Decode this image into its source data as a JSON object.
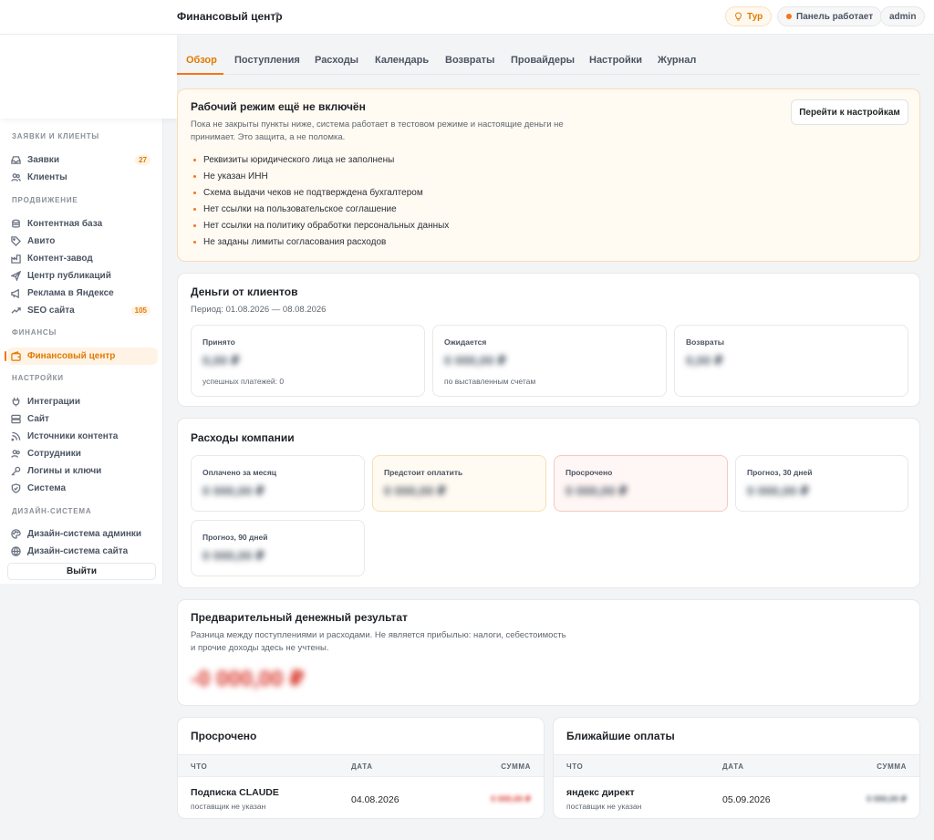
{
  "header": {
    "title": "Финансовый центр",
    "help": "?",
    "tour_label": "Тур",
    "status_label": "Панель работает",
    "user_label": "admin"
  },
  "sidebar": {
    "sections": [
      {
        "label": "ЗАЯВКИ И КЛИЕНТЫ"
      },
      {
        "label": "ПРОДВИЖЕНИЕ"
      },
      {
        "label": "ФИНАНСЫ"
      },
      {
        "label": "НАСТРОЙКИ"
      },
      {
        "label": "ДИЗАЙН-СИСТЕМА"
      }
    ],
    "items": [
      {
        "label": "Заявки",
        "icon": "inbox-icon",
        "badge": "27"
      },
      {
        "label": "Клиенты",
        "icon": "users-icon"
      },
      {
        "label": "Контентная база",
        "icon": "database-icon"
      },
      {
        "label": "Авито",
        "icon": "tag-icon"
      },
      {
        "label": "Контент-завод",
        "icon": "factory-icon"
      },
      {
        "label": "Центр публикаций",
        "icon": "send-icon"
      },
      {
        "label": "Реклама в Яндексе",
        "icon": "megaphone-icon"
      },
      {
        "label": "SEO сайта",
        "icon": "trending-icon",
        "badge": "105"
      },
      {
        "label": "Финансовый центр",
        "icon": "wallet-icon",
        "active": true
      },
      {
        "label": "Интеграции",
        "icon": "plug-icon"
      },
      {
        "label": "Сайт",
        "icon": "server-icon"
      },
      {
        "label": "Источники контента",
        "icon": "rss-icon"
      },
      {
        "label": "Сотрудники",
        "icon": "team-icon"
      },
      {
        "label": "Логины и ключи",
        "icon": "key-icon"
      },
      {
        "label": "Система",
        "icon": "shield-icon"
      },
      {
        "label": "Дизайн-система админки",
        "icon": "palette-icon"
      },
      {
        "label": "Дизайн-система сайта",
        "icon": "globe-icon"
      }
    ],
    "logout_label": "Выйти"
  },
  "tabs": [
    {
      "label": "Обзор",
      "active": true
    },
    {
      "label": "Поступления"
    },
    {
      "label": "Расходы"
    },
    {
      "label": "Календарь"
    },
    {
      "label": "Возвраты"
    },
    {
      "label": "Провайдеры"
    },
    {
      "label": "Настройки"
    },
    {
      "label": "Журнал"
    }
  ],
  "warning": {
    "title": "Рабочий режим ещё не включён",
    "text_line1": "Пока не закрыты пункты ниже, система работает в тестовом режиме и настоящие деньги не",
    "text_line2": "принимает. Это защита, а не поломка.",
    "button_label": "Перейти к настройкам",
    "items": [
      "Реквизиты юридического лица не заполнены",
      "Не указан ИНН",
      "Схема выдачи чеков не подтверждена бухгалтером",
      "Нет ссылки на пользовательское соглашение",
      "Нет ссылки на политику обработки персональных данных",
      "Не заданы лимиты согласования расходов"
    ]
  },
  "client_money": {
    "title": "Деньги от клиентов",
    "period": "Период: 01.08.2026 — 08.08.2026",
    "stats": [
      {
        "label": "Принято",
        "value": "0,00 ₽",
        "sub": "успешных платежей: 0"
      },
      {
        "label": "Ожидается",
        "value": "0 000,00 ₽",
        "sub": "по выставленным счетам"
      },
      {
        "label": "Возвраты",
        "value": "0,00 ₽",
        "sub": ""
      }
    ]
  },
  "expenses": {
    "title": "Расходы компании",
    "stats": [
      {
        "label": "Оплачено за месяц",
        "value": "0 000,00 ₽"
      },
      {
        "label": "Предстоит оплатить",
        "value": "0 000,00 ₽"
      },
      {
        "label": "Просрочено",
        "value": "0 000,00 ₽"
      },
      {
        "label": "Прогноз, 30 дней",
        "value": "0 000,00 ₽"
      },
      {
        "label": "Прогноз, 90 дней",
        "value": "0 000,00 ₽"
      }
    ]
  },
  "result": {
    "title": "Предварительный денежный результат",
    "text_line1": "Разница между поступлениями и расходами. Не является прибылью: налоги, себестоимость",
    "text_line2": "и прочие доходы здесь не учтены.",
    "value": "-0 000,00 ₽"
  },
  "overdue": {
    "title": "Просрочено",
    "columns": [
      "ЧТО",
      "ДАТА",
      "СУММА"
    ],
    "rows": [
      {
        "what": "Подписка CLAUDE",
        "sub": "поставщик не указан",
        "date": "04.08.2026",
        "sum": "0 000,00 ₽"
      }
    ]
  },
  "upcoming": {
    "title": "Ближайшие оплаты",
    "columns": [
      "ЧТО",
      "ДАТА",
      "СУММА"
    ],
    "rows": [
      {
        "what": "яндекс директ",
        "sub": "поставщик не указан",
        "date": "05.09.2026",
        "sum": "0 000,00 ₽"
      }
    ]
  },
  "colors": {
    "accent": "#f97316",
    "accent_text": "#e07b00",
    "danger": "#d9362b"
  }
}
